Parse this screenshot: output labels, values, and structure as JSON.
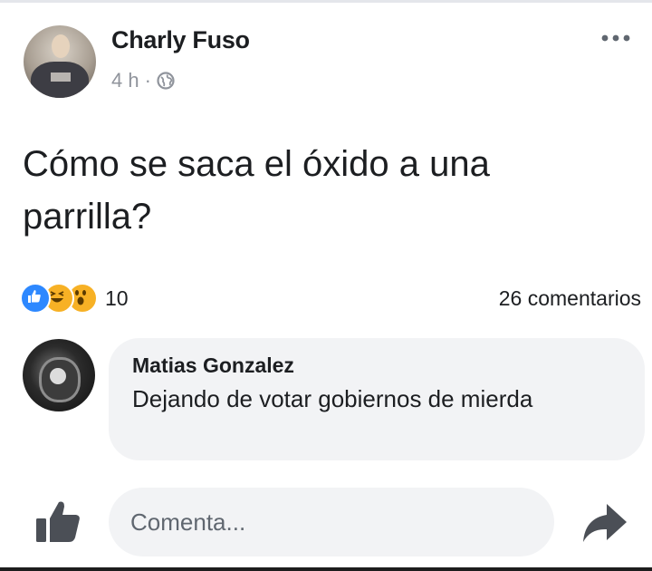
{
  "post": {
    "author": "Charly Fuso",
    "time": "4 h",
    "separator": "·",
    "privacy_icon": "globe-icon",
    "more_icon": "more-horizontal-icon",
    "text": "Cómo se saca el óxido a una parrilla?"
  },
  "reactions": {
    "icons": [
      "like-reaction-icon",
      "haha-reaction-icon",
      "wow-reaction-icon"
    ],
    "count": "10",
    "comments": "26 comentarios"
  },
  "comment": {
    "author": "Matias Gonzalez",
    "text": "Dejando de votar gobiernos de mierda"
  },
  "composer": {
    "like_icon": "thumbs-up-icon",
    "placeholder": "Comenta...",
    "share_icon": "share-arrow-icon"
  },
  "colors": {
    "like_blue": "#2d88ff",
    "reaction_yellow": "#f7b125",
    "bubble_bg": "#f2f3f5",
    "text_primary": "#1c1e21",
    "text_secondary": "#90949c"
  }
}
